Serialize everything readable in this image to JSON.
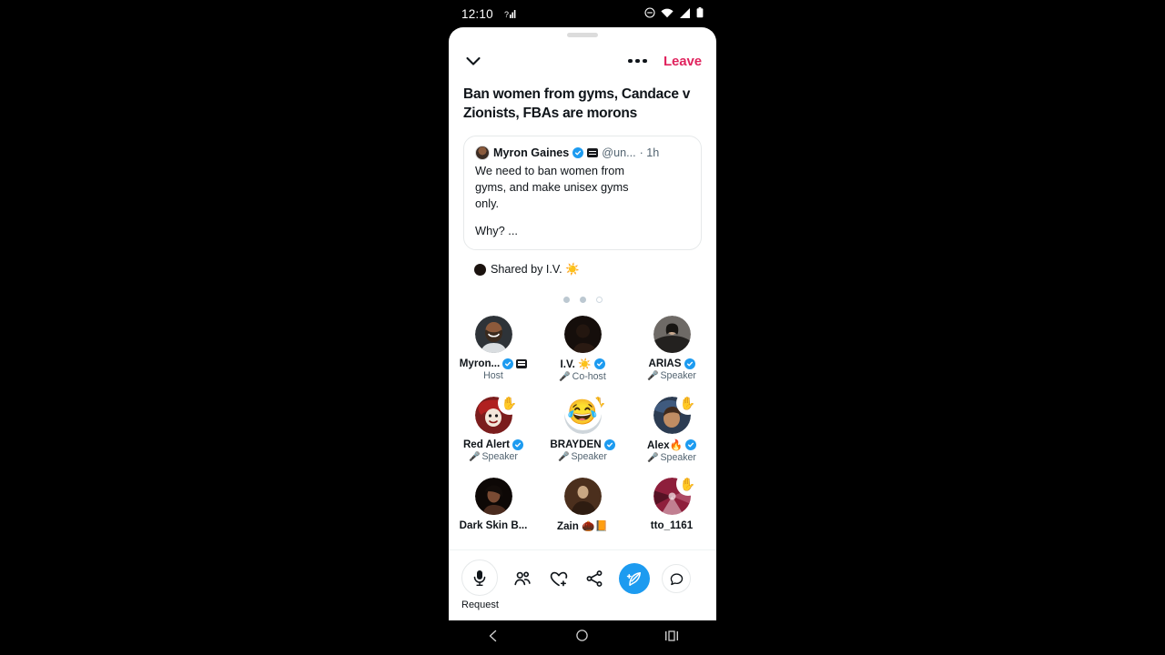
{
  "status_bar": {
    "time": "12:10",
    "icons": [
      "signal-left-icon",
      "dnd-icon",
      "wifi-icon",
      "cellular-icon",
      "battery-icon"
    ]
  },
  "top_bar": {
    "collapse_icon": "chevron-down-icon",
    "more_icon": "more-options-icon",
    "leave_label": "Leave"
  },
  "room": {
    "title": "Ban women from gyms, Candace v\nZionists, FBAs are morons"
  },
  "tweet_card": {
    "author_name": "Myron Gaines",
    "handle": "@un...",
    "timestamp": "· 1h",
    "verified": true,
    "body": "We need to ban women from\ngyms, and make unisex gyms\nonly.",
    "tail": "Why? ..."
  },
  "shared_by": {
    "label": "Shared by I.V. ☀️"
  },
  "pagination": {
    "dots": 3,
    "active_index": 2
  },
  "speakers": [
    {
      "name": "Myron...",
      "role": "Host",
      "verified": true,
      "black_badge": true,
      "mic_muted": false,
      "hand": false,
      "reaction": null,
      "avatar": "man-beard-dark"
    },
    {
      "name": "I.V. ☀️",
      "role": "Co-host",
      "verified": true,
      "black_badge": false,
      "mic_muted": true,
      "hand": false,
      "reaction": null,
      "avatar": "dark-portrait"
    },
    {
      "name": "ARIAS",
      "role": "Speaker",
      "verified": true,
      "black_badge": false,
      "mic_muted": true,
      "hand": false,
      "reaction": null,
      "avatar": "dark-jacket-person"
    },
    {
      "name": "Red Alert",
      "role": "Speaker",
      "verified": true,
      "black_badge": false,
      "mic_muted": true,
      "hand": true,
      "reaction": null,
      "avatar": "clown-red"
    },
    {
      "name": "BRAYDEN",
      "role": "Speaker",
      "verified": true,
      "black_badge": false,
      "mic_muted": true,
      "hand": true,
      "reaction": "😂",
      "avatar": "laughing-emoji"
    },
    {
      "name": "Alex🔥",
      "role": "Speaker",
      "verified": true,
      "black_badge": false,
      "mic_muted": true,
      "hand": true,
      "reaction": null,
      "avatar": "person-blue-cap"
    },
    {
      "name": "Dark Skin B...",
      "role": "",
      "verified": false,
      "black_badge": false,
      "mic_muted": false,
      "hand": false,
      "reaction": null,
      "avatar": "woman-dark"
    },
    {
      "name": "Zain 🌰📙",
      "role": "",
      "verified": false,
      "black_badge": false,
      "mic_muted": false,
      "hand": false,
      "reaction": null,
      "avatar": "sepia-portrait"
    },
    {
      "name": "tto_1161",
      "role": "",
      "verified": false,
      "black_badge": false,
      "mic_muted": false,
      "hand": true,
      "reaction": null,
      "avatar": "maroon-swirl"
    }
  ],
  "toolbar": {
    "request_label": "Request",
    "items": [
      {
        "icon": "microphone-icon",
        "label": "Request"
      },
      {
        "icon": "people-add-icon",
        "label": ""
      },
      {
        "icon": "heart-plus-icon",
        "label": ""
      },
      {
        "icon": "share-icon",
        "label": ""
      },
      {
        "icon": "compose-tweet-icon",
        "label": ""
      },
      {
        "icon": "chat-bubble-icon",
        "label": ""
      }
    ],
    "accent_color": "#1d9bf0"
  },
  "android_nav": {
    "back_icon": "back-chevron-icon",
    "home_icon": "home-circle-icon",
    "recents_icon": "recents-icon"
  },
  "colors": {
    "accent": "#1d9bf0",
    "leave": "#e0245e",
    "text": "#0f1419",
    "muted": "#536471"
  }
}
